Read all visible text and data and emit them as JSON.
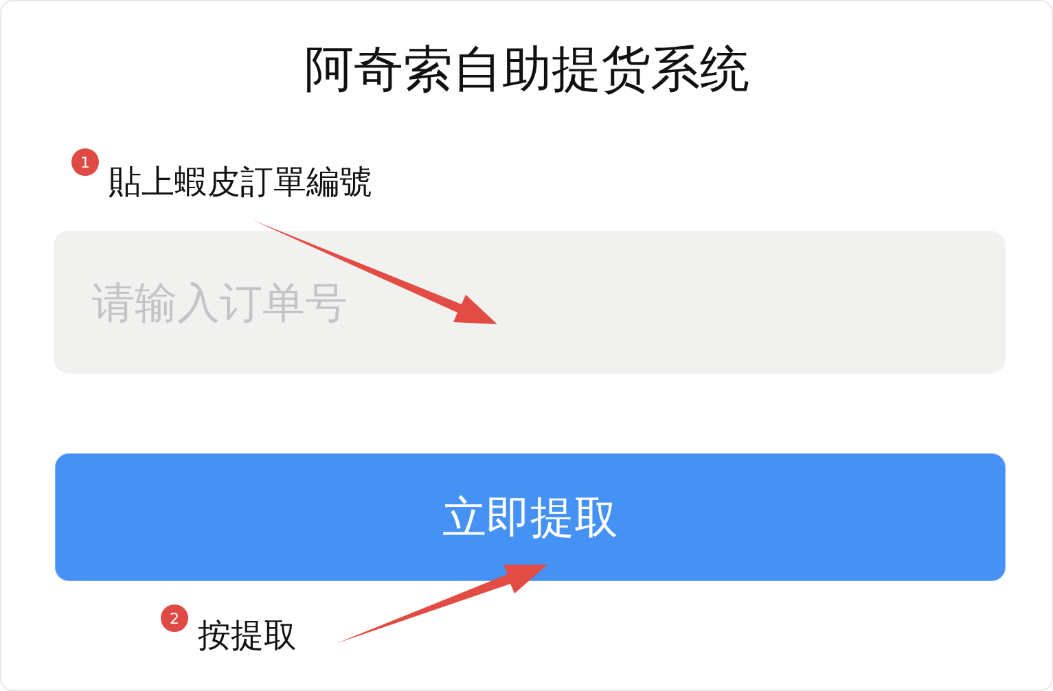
{
  "title": "阿奇索自助提货系统",
  "steps": [
    {
      "number": "1",
      "text": "貼上蝦皮訂單編號"
    },
    {
      "number": "2",
      "text": "按提取"
    }
  ],
  "order_field": {
    "placeholder": "请输入订单号"
  },
  "submit_button": {
    "label": "立即提取"
  }
}
